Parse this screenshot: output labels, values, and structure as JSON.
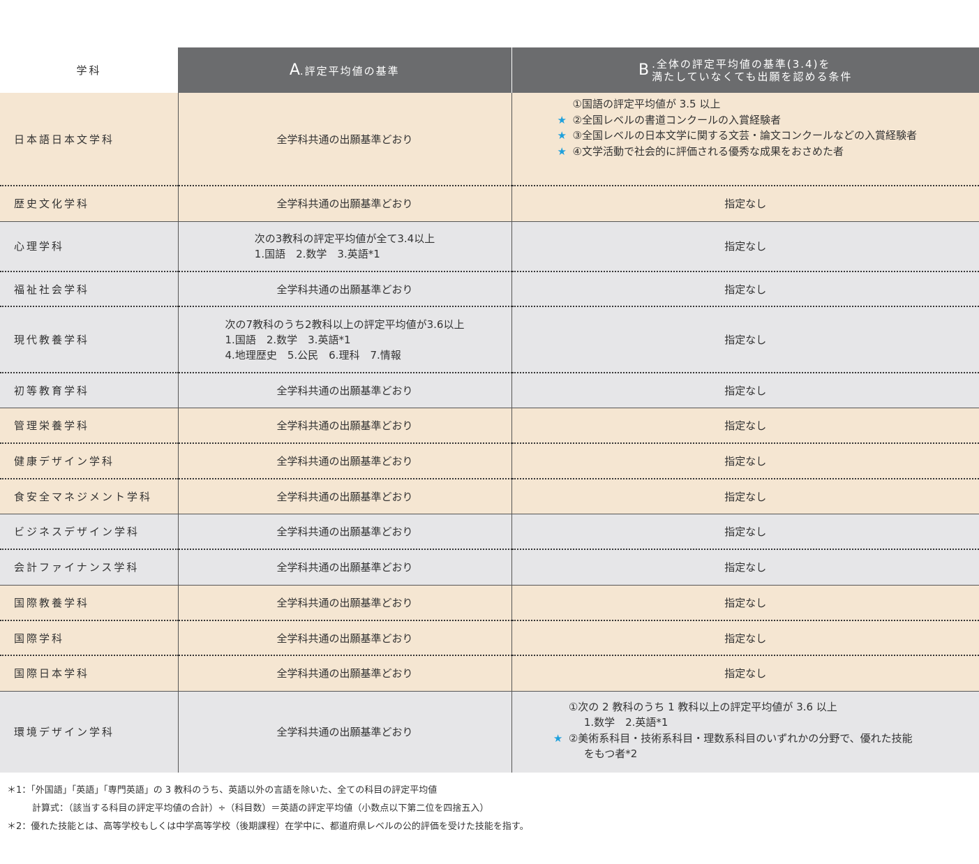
{
  "header": {
    "dept_col": "学科",
    "a_mark": "A",
    "a_label": ".評定平均値の基準",
    "b_mark": "B",
    "b_line1": ".全体の評定平均値の基準(3.4)を",
    "b_line2": "満たしていなくても出願を認める条件"
  },
  "common": "全学科共通の出願基準どおり",
  "none": "指定なし",
  "star": "★",
  "rows": [
    {
      "dept": "日本語日本文学科",
      "a": "全学科共通の出願基準どおり",
      "b_lines": [
        {
          "star": false,
          "text": "①国語の評定平均値が 3.5 以上"
        },
        {
          "star": true,
          "text": "②全国レベルの書道コンクールの入賞経験者"
        },
        {
          "star": true,
          "text": "③全国レベルの日本文学に関する文芸・論文コンクールなどの入賞経験者"
        },
        {
          "star": true,
          "text": "④文学活動で社会的に評価される優秀な成果をおさめた者"
        }
      ]
    },
    {
      "dept": "歴史文化学科",
      "a": "全学科共通の出願基準どおり",
      "b": "指定なし"
    },
    {
      "dept": "心理学科",
      "a_lines": [
        "次の3教科の評定平均値が全て3.4以上",
        "1.国語　2.数学　3.英語*1"
      ],
      "b": "指定なし"
    },
    {
      "dept": "福祉社会学科",
      "a": "全学科共通の出願基準どおり",
      "b": "指定なし"
    },
    {
      "dept": "現代教養学科",
      "a_lines": [
        "次の7教科のうち2教科以上の評定平均値が3.6以上",
        "1.国語　2.数学　3.英語*1",
        "4.地理歴史　5.公民　6.理科　7.情報"
      ],
      "b": "指定なし"
    },
    {
      "dept": "初等教育学科",
      "a": "全学科共通の出願基準どおり",
      "b": "指定なし"
    },
    {
      "dept": "管理栄養学科",
      "a": "全学科共通の出願基準どおり",
      "b": "指定なし"
    },
    {
      "dept": "健康デザイン学科",
      "a": "全学科共通の出願基準どおり",
      "b": "指定なし"
    },
    {
      "dept": "食安全マネジメント学科",
      "a": "全学科共通の出願基準どおり",
      "b": "指定なし"
    },
    {
      "dept": "ビジネスデザイン学科",
      "a": "全学科共通の出願基準どおり",
      "b": "指定なし"
    },
    {
      "dept": "会計ファイナンス学科",
      "a": "全学科共通の出願基準どおり",
      "b": "指定なし"
    },
    {
      "dept": "国際教養学科",
      "a": "全学科共通の出願基準どおり",
      "b": "指定なし"
    },
    {
      "dept": "国際学科",
      "a": "全学科共通の出願基準どおり",
      "b": "指定なし"
    },
    {
      "dept": "国際日本学科",
      "a": "全学科共通の出願基準どおり",
      "b": "指定なし"
    },
    {
      "dept": "環境デザイン学科",
      "a": "全学科共通の出願基準どおり",
      "b_lines": [
        {
          "star": false,
          "text": "①次の 2 教科のうち 1 教科以上の評定平均値が 3.6 以上"
        },
        {
          "star": false,
          "indent": true,
          "text": "1.数学　2.英語*1"
        },
        {
          "star": true,
          "text": "②美術系科目・技術系科目・理数系科目のいずれかの分野で、優れた技能"
        },
        {
          "star": false,
          "indent": true,
          "text": "をもつ者*2"
        }
      ]
    }
  ],
  "notes": {
    "n1": "＊1：「外国語」「英語」「専門英語」の 3 教科のうち、英語以外の言語を除いた、全ての科目の評定平均値",
    "n1_formula": "計算式：（該当する科目の評定平均値の合計）÷（科目数）＝英語の評定平均値（小数点以下第二位を四捨五入）",
    "n2": "＊2：優れた技能とは、高等学校もしくは中学高等学校（後期課程）在学中に、都道府県レベルの公的評価を受けた技能を指す。"
  },
  "colors": {
    "beige": "#f5e6d2",
    "gray": "#e6e6e8",
    "header": "#6b6c6e",
    "star": "#1ea0dc"
  }
}
